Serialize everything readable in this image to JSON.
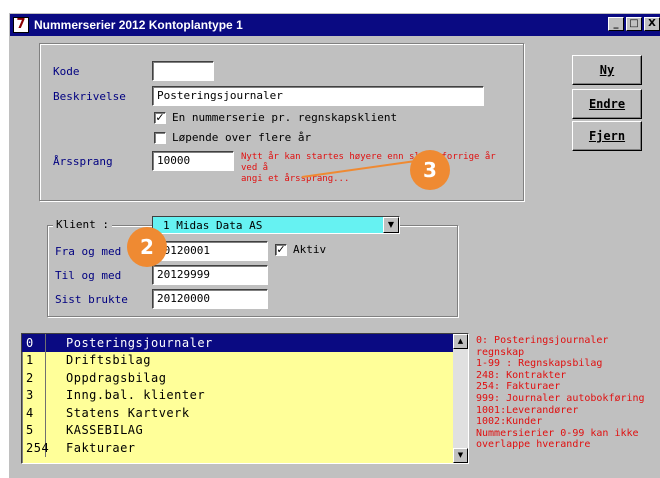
{
  "window": {
    "title": "Nummerserier 2012 Kontoplantype 1",
    "icon_glyph": "7",
    "min_glyph": "_",
    "max_glyph": "□",
    "close_glyph": "X"
  },
  "form": {
    "kode_label": "Kode",
    "kode_value": "",
    "beskrivelse_label": "Beskrivelse",
    "beskrivelse_value": "Posteringsjournaler",
    "chk_en_label": "En nummerserie pr. regnskapsklient",
    "chk_en_checked": true,
    "chk_lopende_label": "Løpende over flere år",
    "chk_lopende_checked": false,
    "arssprang_label": "Årssprang",
    "arssprang_value": "10000",
    "arssprang_note_1": "Nytt år kan startes høyere enn slutt forrige år ved å",
    "arssprang_note_2": "angi et årssprang..."
  },
  "buttons": {
    "ny": "Ny",
    "endre": "Endre",
    "fjern": "Fjern"
  },
  "klient": {
    "group_label": "Klient :",
    "selected": "1  Midas Data AS",
    "fra_label": "Fra og med",
    "fra_value": "20120001",
    "aktiv_label": "Aktiv",
    "aktiv_checked": true,
    "til_label": "Til og med",
    "til_value": "20129999",
    "sist_label": "Sist brukte",
    "sist_value": "20120000"
  },
  "list": {
    "rows": [
      {
        "code": "0",
        "name": "Posteringsjournaler"
      },
      {
        "code": "1",
        "name": "Driftsbilag"
      },
      {
        "code": "2",
        "name": "Oppdragsbilag"
      },
      {
        "code": "3",
        "name": "Inng.bal. klienter"
      },
      {
        "code": "4",
        "name": "Statens Kartverk"
      },
      {
        "code": "5",
        "name": "KASSEBILAG"
      },
      {
        "code": "254",
        "name": "Fakturaer"
      }
    ],
    "selected_index": 0
  },
  "legend": [
    "0: Posteringsjournaler regnskap",
    "1-99 : Regnskapsbilag",
    "248: Kontrakter",
    "254: Fakturaer",
    "999: Journaler autobokføring",
    "1001:Leverandører",
    "1002:Kunder",
    "Nummersierier 0-99 kan ikke",
    "overlappe hverandre"
  ],
  "callouts": {
    "badge_2": "2",
    "badge_3": "3"
  },
  "colors": {
    "titlebar": "#0a0a82",
    "window_bg": "#c0c0c0",
    "label": "#000080",
    "note_red": "#e01010",
    "combo_bg": "#66f2f2",
    "list_bg": "#ffff99",
    "callout_orange": "#ef8a32"
  }
}
